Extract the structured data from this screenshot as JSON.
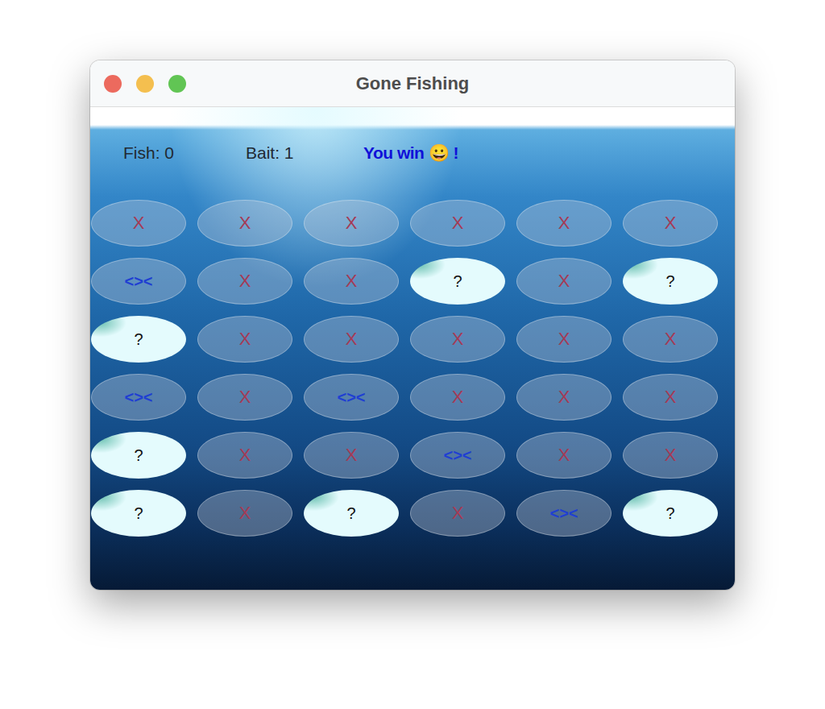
{
  "window": {
    "title": "Gone Fishing"
  },
  "status": {
    "fish": "Fish: 0",
    "bait": "Bait: 1",
    "message": "You win 😀 !"
  },
  "grid": [
    [
      {
        "label": "X",
        "kind": "miss"
      },
      {
        "label": "X",
        "kind": "miss"
      },
      {
        "label": "X",
        "kind": "miss"
      },
      {
        "label": "X",
        "kind": "miss"
      },
      {
        "label": "X",
        "kind": "miss"
      },
      {
        "label": "X",
        "kind": "miss"
      }
    ],
    [
      {
        "label": "<><",
        "kind": "fish"
      },
      {
        "label": "X",
        "kind": "miss"
      },
      {
        "label": "X",
        "kind": "miss"
      },
      {
        "label": "?",
        "kind": "hidden"
      },
      {
        "label": "X",
        "kind": "miss"
      },
      {
        "label": "?",
        "kind": "hidden"
      }
    ],
    [
      {
        "label": "?",
        "kind": "hidden"
      },
      {
        "label": "X",
        "kind": "miss"
      },
      {
        "label": "X",
        "kind": "miss"
      },
      {
        "label": "X",
        "kind": "miss"
      },
      {
        "label": "X",
        "kind": "miss"
      },
      {
        "label": "X",
        "kind": "miss"
      }
    ],
    [
      {
        "label": "<><",
        "kind": "fish"
      },
      {
        "label": "X",
        "kind": "miss"
      },
      {
        "label": "<><",
        "kind": "fish"
      },
      {
        "label": "X",
        "kind": "miss"
      },
      {
        "label": "X",
        "kind": "miss"
      },
      {
        "label": "X",
        "kind": "miss"
      }
    ],
    [
      {
        "label": "?",
        "kind": "hidden"
      },
      {
        "label": "X",
        "kind": "miss"
      },
      {
        "label": "X",
        "kind": "miss"
      },
      {
        "label": "<><",
        "kind": "fish"
      },
      {
        "label": "X",
        "kind": "miss"
      },
      {
        "label": "X",
        "kind": "miss"
      }
    ],
    [
      {
        "label": "?",
        "kind": "hidden"
      },
      {
        "label": "X",
        "kind": "miss"
      },
      {
        "label": "?",
        "kind": "hidden"
      },
      {
        "label": "X",
        "kind": "miss"
      },
      {
        "label": "<><",
        "kind": "fish"
      },
      {
        "label": "?",
        "kind": "hidden"
      }
    ]
  ]
}
